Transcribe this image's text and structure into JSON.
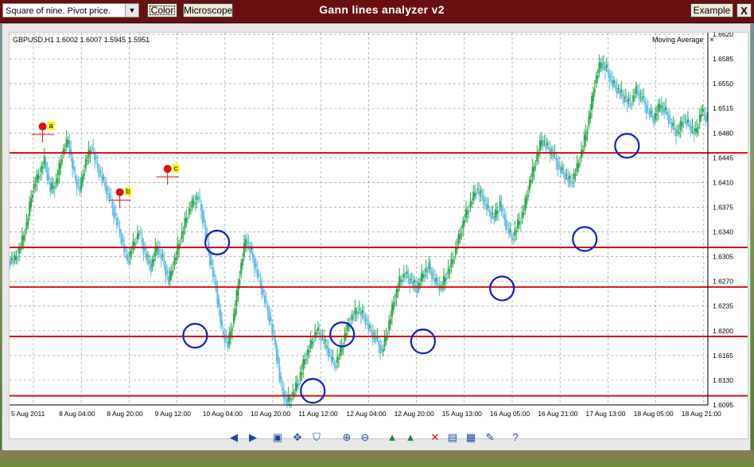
{
  "window": {
    "title": "Gann lines analyzer v2",
    "method_select_value": "Square of nine. Pivot price.",
    "color_button": "Color",
    "microscope_button": "Microscope",
    "example_button": "Example",
    "close_button": "X"
  },
  "chart_data": {
    "type": "candlestick",
    "symbol_info": "GBPUSD,H1  1.6002 1.6007 1.5945 1.5951",
    "indicator_label": "Moving Average",
    "indicator_close": "×",
    "x_labels": [
      "5 Aug 2011",
      "8 Aug 04:00",
      "8 Aug 20:00",
      "9 Aug 12:00",
      "10 Aug 04:00",
      "10 Aug 20:00",
      "11 Aug 12:00",
      "12 Aug 04:00",
      "12 Aug 20:00",
      "15 Aug 13:00",
      "16 Aug 05:00",
      "16 Aug 21:00",
      "17 Aug 13:00",
      "18 Aug 05:00",
      "18 Aug 21:00"
    ],
    "y_labels": [
      "1.6620",
      "1.6585",
      "1.6550",
      "1.6515",
      "1.6480",
      "1.6445",
      "1.6410",
      "1.6375",
      "1.6340",
      "1.6305",
      "1.6270",
      "1.6235",
      "1.6200",
      "1.6165",
      "1.6130",
      "1.6095"
    ],
    "ylim": [
      1.6095,
      1.662
    ],
    "gann_levels": [
      1.6452,
      1.6318,
      1.6262,
      1.6192,
      1.6108
    ],
    "price_series": [
      1.63,
      1.632,
      1.635,
      1.64,
      1.642,
      1.644,
      1.64,
      1.641,
      1.645,
      1.647,
      1.642,
      1.64,
      1.644,
      1.646,
      1.643,
      1.641,
      1.639,
      1.636,
      1.633,
      1.63,
      1.632,
      1.634,
      1.631,
      1.629,
      1.632,
      1.63,
      1.627,
      1.63,
      1.633,
      1.636,
      1.638,
      1.639,
      1.635,
      1.63,
      1.626,
      1.62,
      1.618,
      1.622,
      1.628,
      1.633,
      1.631,
      1.628,
      1.625,
      1.622,
      1.618,
      1.612,
      1.61,
      1.611,
      1.613,
      1.616,
      1.618,
      1.62,
      1.619,
      1.617,
      1.615,
      1.617,
      1.62,
      1.622,
      1.623,
      1.622,
      1.62,
      1.619,
      1.617,
      1.62,
      1.624,
      1.627,
      1.628,
      1.627,
      1.626,
      1.628,
      1.629,
      1.627,
      1.626,
      1.628,
      1.63,
      1.633,
      1.636,
      1.638,
      1.64,
      1.639,
      1.637,
      1.636,
      1.638,
      1.635,
      1.633,
      1.635,
      1.637,
      1.641,
      1.644,
      1.647,
      1.646,
      1.645,
      1.643,
      1.642,
      1.641,
      1.643,
      1.646,
      1.65,
      1.655,
      1.658,
      1.657,
      1.655,
      1.654,
      1.653,
      1.652,
      1.654,
      1.653,
      1.651,
      1.65,
      1.652,
      1.651,
      1.649,
      1.648,
      1.65,
      1.649,
      1.648,
      1.651,
      1.65
    ],
    "markers": [
      {
        "label": "a",
        "x": 1.8,
        "price": 1.6478
      },
      {
        "label": "b",
        "x": 6.0,
        "price": 1.6385
      },
      {
        "label": "c",
        "x": 8.6,
        "price": 1.6418
      }
    ],
    "circles": [
      {
        "x": 10.1,
        "price": 1.6193
      },
      {
        "x": 11.3,
        "price": 1.6325
      },
      {
        "x": 16.5,
        "price": 1.6115
      },
      {
        "x": 18.1,
        "price": 1.6195
      },
      {
        "x": 22.5,
        "price": 1.6185
      },
      {
        "x": 26.8,
        "price": 1.626
      },
      {
        "x": 31.3,
        "price": 1.633
      },
      {
        "x": 33.6,
        "price": 1.6462
      }
    ],
    "series": [
      {
        "values": [],
        "colors": [
          "#2aa84a",
          "#5bb8e8"
        ]
      }
    ]
  },
  "toolbar_icons": [
    "prev-icon",
    "next-icon",
    "fit-icon",
    "move-icon",
    "crop-icon",
    "zoom-in-icon",
    "zoom-out-icon",
    "trend-up-icon",
    "trend-down-icon",
    "delete-icon",
    "print-icon",
    "save-icon",
    "edit-icon",
    "help-icon"
  ],
  "colors": {
    "title_bar": "#6a0f0f",
    "gann_line": "#d01010",
    "circle": "#1020c0",
    "up_candle": "#2aa84a",
    "down_candle": "#5bb8e8"
  }
}
